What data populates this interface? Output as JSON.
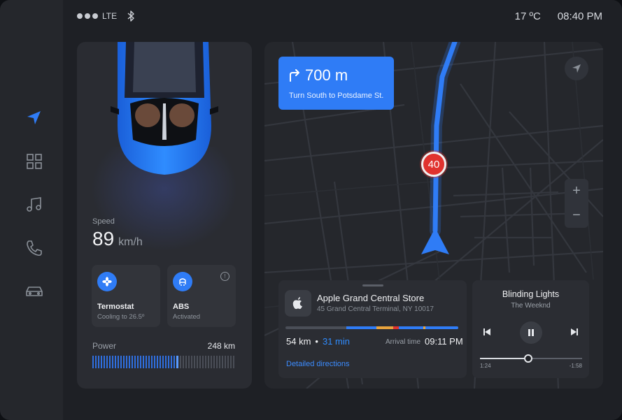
{
  "status": {
    "network": "LTE",
    "temperature": "17 ºC",
    "time": "08:40 PM"
  },
  "sidebar": {
    "items": [
      {
        "name": "navigation",
        "icon": "navigation-arrow-icon",
        "active": true
      },
      {
        "name": "apps",
        "icon": "grid-icon",
        "active": false
      },
      {
        "name": "music",
        "icon": "music-note-icon",
        "active": false
      },
      {
        "name": "phone",
        "icon": "phone-icon",
        "active": false
      },
      {
        "name": "car",
        "icon": "car-icon",
        "active": false
      }
    ]
  },
  "vehicle": {
    "speed_label": "Speed",
    "speed_value": "89",
    "speed_unit": "km/h",
    "tiles": [
      {
        "title": "Termostat",
        "subtitle": "Cooling to 26.5º",
        "icon": "fan-icon"
      },
      {
        "title": "ABS",
        "subtitle": "Activated",
        "icon": "abs-icon"
      }
    ],
    "power_label": "Power",
    "power_value": "248 km",
    "power_level": 0.6
  },
  "navigation": {
    "distance": "700 m",
    "instruction": "Turn South to Potsdame St.",
    "speed_limit": "40",
    "zoom_in": "+",
    "zoom_out": "−"
  },
  "destination": {
    "name": "Apple Grand Central Store",
    "address": "45 Grand Central Terminal, NY 10017",
    "distance": "54 km",
    "separator": "•",
    "duration": "31 min",
    "arrival_label": "Arrival time",
    "arrival_time": "09:11 PM",
    "link": "Detailed directions"
  },
  "music": {
    "title": "Blinding Lights",
    "artist": "The Weeknd",
    "elapsed": "1:24",
    "remaining": "-1:58",
    "progress": 0.47
  },
  "colors": {
    "accent": "#2f7cf6",
    "warning": "#e0322e",
    "traffic_orange": "#e8a33d"
  }
}
